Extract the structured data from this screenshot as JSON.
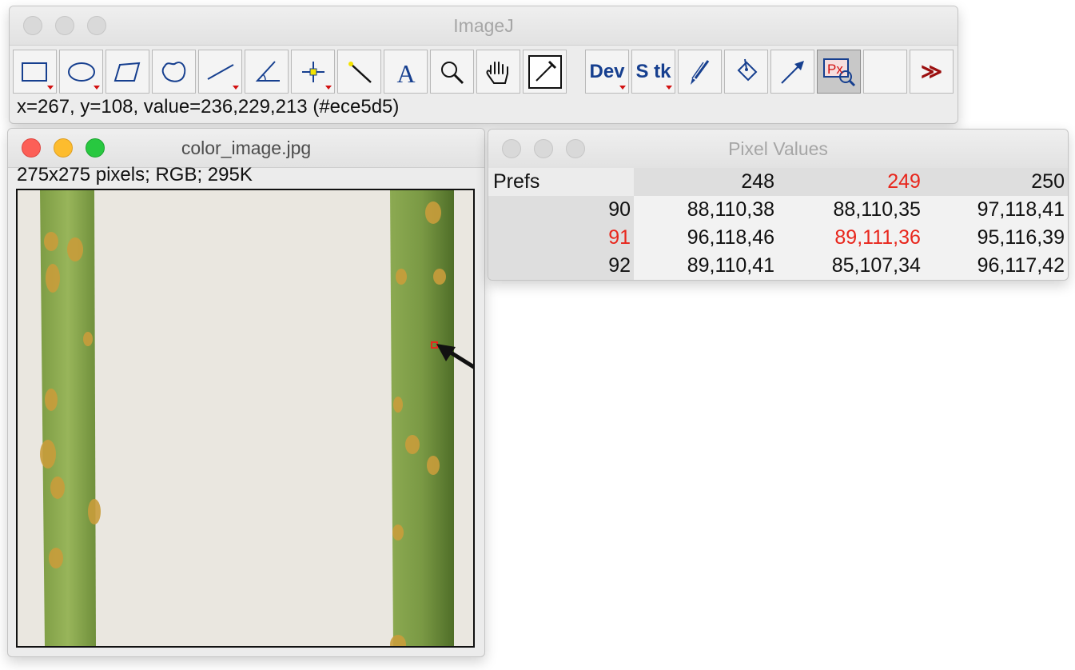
{
  "imagej": {
    "title": "ImageJ",
    "tools": [
      {
        "name": "rectangle-tool",
        "icon": "rectangle-selection-icon",
        "has_menu": true
      },
      {
        "name": "oval-tool",
        "icon": "oval-selection-icon",
        "has_menu": true
      },
      {
        "name": "polygon-tool",
        "icon": "polygon-selection-icon",
        "has_menu": false
      },
      {
        "name": "freehand-tool",
        "icon": "freehand-selection-icon",
        "has_menu": false
      },
      {
        "name": "line-tool",
        "icon": "straight-line-icon",
        "has_menu": true
      },
      {
        "name": "angle-tool",
        "icon": "angle-icon",
        "has_menu": false
      },
      {
        "name": "point-tool",
        "icon": "point-crosshair-icon",
        "has_menu": true
      },
      {
        "name": "wand-tool",
        "icon": "magic-wand-icon",
        "has_menu": false
      },
      {
        "name": "text-tool",
        "icon": "text-icon",
        "has_menu": false
      },
      {
        "name": "zoom-tool",
        "icon": "magnifier-icon",
        "has_menu": false
      },
      {
        "name": "scroll-tool",
        "icon": "hand-icon",
        "has_menu": false
      },
      {
        "name": "color-picker-tool",
        "icon": "eyedropper-icon",
        "has_menu": false
      }
    ],
    "dev_label": "Dev",
    "stk_label": "S tk",
    "px_label": "Px",
    "more_label": "≫",
    "status": "x=267, y=108, value=236,229,213 (#ece5d5)"
  },
  "image_window": {
    "title": "color_image.jpg",
    "info": "275x275 pixels; RGB; 295K"
  },
  "pixel_values": {
    "title": "Pixel Values",
    "prefs_label": "Prefs",
    "columns": [
      "248",
      "249",
      "250"
    ],
    "highlight_column": "249",
    "rows": [
      {
        "label": "90",
        "values": [
          "88,110,38",
          "88,110,35",
          "97,118,41"
        ]
      },
      {
        "label": "91",
        "values": [
          "96,118,46",
          "89,111,36",
          "95,116,39"
        ]
      },
      {
        "label": "92",
        "values": [
          "89,110,41",
          "85,107,34",
          "96,117,42"
        ]
      }
    ],
    "highlight_row": "91",
    "highlight_color": "#e8261c"
  }
}
